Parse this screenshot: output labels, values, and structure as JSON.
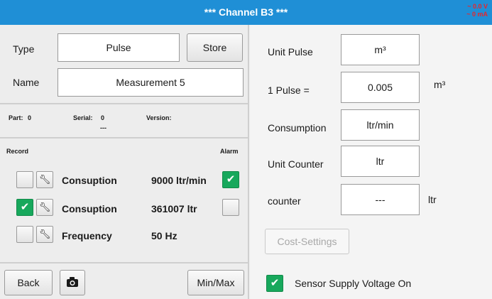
{
  "title": "*** Channel B3 ***",
  "status": {
    "voltage": "~ 0.0 V",
    "current": "~ 0 mA"
  },
  "left": {
    "type_label": "Type",
    "type_value": "Pulse",
    "store_label": "Store",
    "name_label": "Name",
    "name_value": "Measurement 5",
    "info": {
      "part_label": "Part:",
      "part_value": "0",
      "serial_label": "Serial:",
      "serial_value": "0",
      "serial_extra": "---",
      "version_label": "Version:"
    },
    "record_label": "Record",
    "alarm_label": "Alarm",
    "rows": [
      {
        "name": "Consuption",
        "value": "9000 ltr/min",
        "record": false,
        "alarm": true
      },
      {
        "name": "Consuption",
        "value": "361007 ltr",
        "record": true,
        "alarm": false
      },
      {
        "name": "Frequency",
        "value": "50 Hz",
        "record": false,
        "alarm": null
      }
    ],
    "back_label": "Back",
    "minmax_label": "Min/Max"
  },
  "right": {
    "unit_pulse_label": "Unit Pulse",
    "unit_pulse_value": "m³",
    "one_pulse_label": "1 Pulse =",
    "one_pulse_value": "0.005",
    "one_pulse_unit": "m³",
    "consumption_label": "Consumption",
    "consumption_value": "ltr/min",
    "unit_counter_label": "Unit Counter",
    "unit_counter_value": "ltr",
    "counter_label": "counter",
    "counter_value": "---",
    "counter_unit": "ltr",
    "cost_settings_label": "Cost-Settings",
    "sensor_supply_label": "Sensor Supply Voltage On",
    "sensor_supply_on": true
  }
}
